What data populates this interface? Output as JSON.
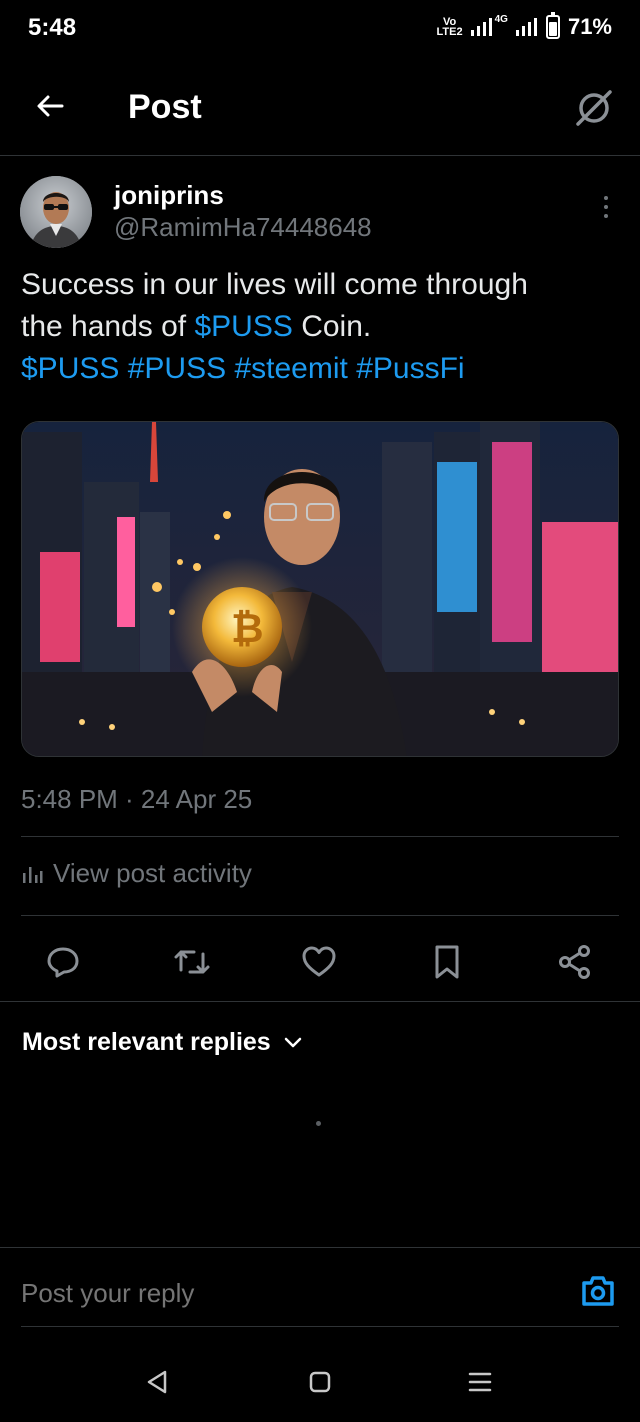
{
  "status_bar": {
    "time": "5:48",
    "volte_top": "Vo",
    "volte_bottom": "LTE2",
    "network": "4G",
    "battery": "71%",
    "battery_level": 0.71
  },
  "header": {
    "title": "Post",
    "back_icon": "arrow-left-icon",
    "grok_icon": "grok-icon"
  },
  "post": {
    "author": {
      "name": "joniprins",
      "handle": "@RamimHa74448648"
    },
    "text": {
      "line1": "Success in our lives will come through",
      "line2_pre": "the hands of ",
      "line2_tag": "$PUSS",
      "line2_post": " Coin.",
      "tags": [
        "$PUSS",
        "#PUSS",
        "#steemit",
        "#PussFi"
      ]
    },
    "timestamp": "5:48 PM · 24 Apr 25",
    "activity_label": "View post activity"
  },
  "actions": [
    "reply-icon",
    "repost-icon",
    "like-icon",
    "bookmark-icon",
    "share-icon"
  ],
  "replies": {
    "sort_label": "Most relevant replies"
  },
  "reply_bar": {
    "placeholder": "Post your reply"
  },
  "colors": {
    "background": "#000000",
    "accent": "#1d9bf0",
    "muted": "#71767b",
    "divider": "#2f3336"
  }
}
